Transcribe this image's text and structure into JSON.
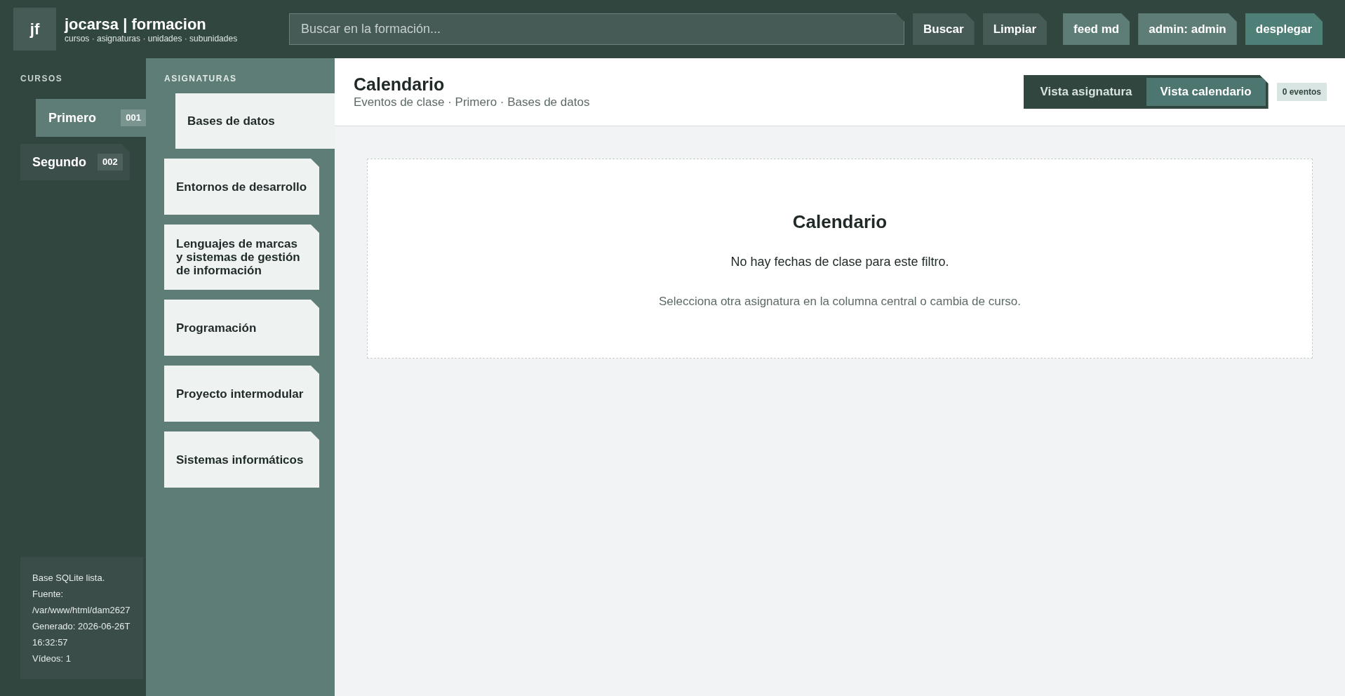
{
  "header": {
    "logo": "jf",
    "title": "jocarsa | formacion",
    "subtitle": "cursos · asignaturas · unidades · subunidades",
    "search": {
      "placeholder": "Buscar en la formación..."
    },
    "buttons": [
      {
        "label": "Buscar",
        "kind": "tool"
      },
      {
        "label": "Limpiar",
        "kind": "tool"
      },
      {
        "label": "feed md",
        "kind": "account"
      },
      {
        "label": "admin: admin",
        "kind": "account"
      },
      {
        "label": "desplegar",
        "kind": "action"
      }
    ]
  },
  "cursos": {
    "label": "CURSOS",
    "items": [
      {
        "name": "Primero",
        "code": "001",
        "selected": true
      },
      {
        "name": "Segundo",
        "code": "002",
        "selected": false
      }
    ]
  },
  "status": [
    "Base SQLite lista.",
    "Fuente:",
    "/var/www/html/dam2627",
    "Generado: 2026-06-26T16:32:57",
    "Vídeos: 1"
  ],
  "asignaturas": {
    "label": "ASIGNATURAS",
    "items": [
      {
        "name": "Bases de datos",
        "selected": true
      },
      {
        "name": "Entornos de desarrollo",
        "selected": false
      },
      {
        "name": "Lenguajes de marcas y sistemas de gestión de información",
        "selected": false
      },
      {
        "name": "Programación",
        "selected": false
      },
      {
        "name": "Proyecto intermodular",
        "selected": false
      },
      {
        "name": "Sistemas informáticos",
        "selected": false
      }
    ]
  },
  "main": {
    "title": "Calendario",
    "breadcrumb": "Eventos de clase · Primero · Bases de datos",
    "views": [
      {
        "label": "Vista asignatura",
        "selected": false
      },
      {
        "label": "Vista calendario",
        "selected": true
      }
    ],
    "badge": "0 eventos",
    "card": {
      "title": "Calendario",
      "message": "No hay fechas de clase para este filtro.",
      "hint": "Selecciona otra asignatura en la columna central o cambia de curso."
    }
  }
}
